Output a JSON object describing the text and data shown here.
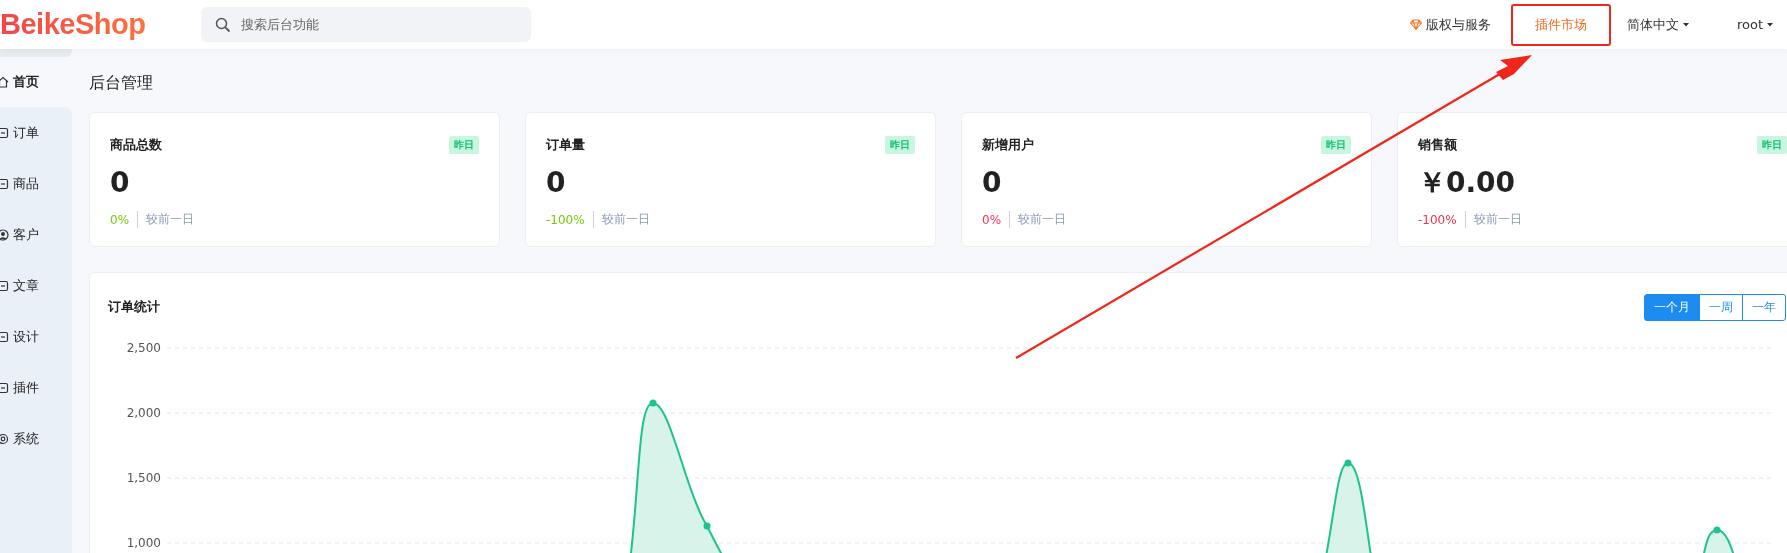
{
  "header": {
    "logo": "BeikeShop",
    "search": {
      "placeholder": "搜索后台功能"
    },
    "nav": [
      {
        "label": "版权与服务",
        "kind": "icon_link",
        "highlighted": false
      },
      {
        "label": "插件市场",
        "kind": "link",
        "highlighted": true
      },
      {
        "label": "简体中文",
        "kind": "dropdown",
        "highlighted": false
      },
      {
        "label": "root",
        "kind": "dropdown",
        "highlighted": false
      }
    ]
  },
  "sidebar": {
    "items": [
      {
        "label": "首页",
        "selected": true
      },
      {
        "label": "订单",
        "selected": false
      },
      {
        "label": "商品",
        "selected": false
      },
      {
        "label": "客户",
        "selected": false
      },
      {
        "label": "文章",
        "selected": false
      },
      {
        "label": "设计",
        "selected": false
      },
      {
        "label": "插件",
        "selected": false
      },
      {
        "label": "系统",
        "selected": false
      }
    ]
  },
  "page_title": "后台管理",
  "stat_cards": [
    {
      "title": "商品总数",
      "badge": "昨日",
      "value": "0",
      "change": "0%",
      "color": "#7ac70c",
      "compare": "较前一日"
    },
    {
      "title": "订单量",
      "badge": "昨日",
      "value": "0",
      "change": "-100%",
      "color": "#7ac70c",
      "compare": "较前一日"
    },
    {
      "title": "新增用户",
      "badge": "昨日",
      "value": "0",
      "change": "0%",
      "color": "#f0344f",
      "compare": "较前一日"
    },
    {
      "title": "销售额",
      "badge": "昨日",
      "value": "￥0.00",
      "change": "-100%",
      "color": "#f0344f",
      "compare": "较前一日"
    }
  ],
  "order_chart": {
    "title": "订单统计",
    "periods": [
      {
        "label": "一个月",
        "selected": true
      },
      {
        "label": "一周",
        "selected": false
      },
      {
        "label": "一年",
        "selected": false
      }
    ],
    "y_tick_labels": [
      "2,500",
      "2,000",
      "1,500",
      "1,000"
    ]
  },
  "arrow_annotation": true
}
